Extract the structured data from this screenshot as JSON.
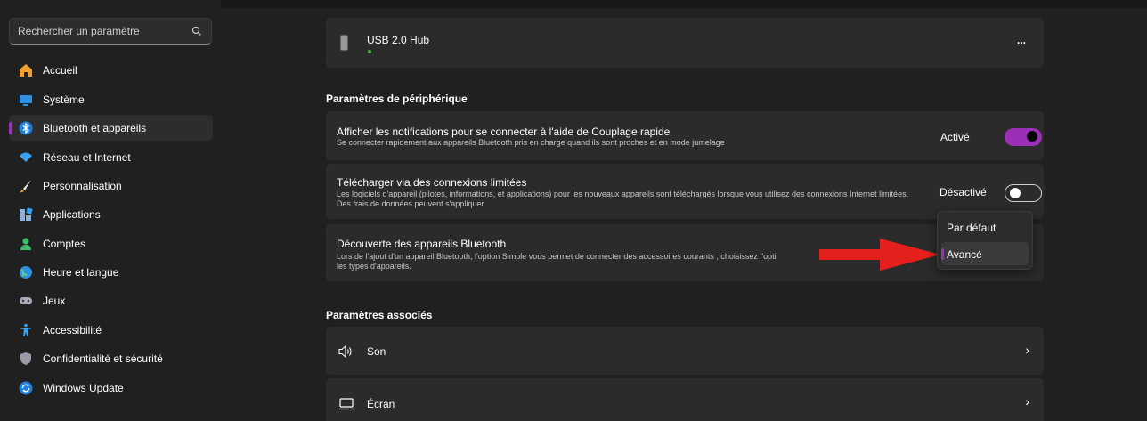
{
  "search": {
    "placeholder": "Rechercher un paramètre"
  },
  "sidebar": {
    "items": [
      {
        "label": "Accueil",
        "icon": "home-icon"
      },
      {
        "label": "Système",
        "icon": "system-icon"
      },
      {
        "label": "Bluetooth et appareils",
        "icon": "bluetooth-icon",
        "selected": true
      },
      {
        "label": "Réseau et Internet",
        "icon": "wifi-icon"
      },
      {
        "label": "Personnalisation",
        "icon": "brush-icon"
      },
      {
        "label": "Applications",
        "icon": "apps-icon"
      },
      {
        "label": "Comptes",
        "icon": "account-icon"
      },
      {
        "label": "Heure et langue",
        "icon": "globe-icon"
      },
      {
        "label": "Jeux",
        "icon": "gamepad-icon"
      },
      {
        "label": "Accessibilité",
        "icon": "accessibility-icon"
      },
      {
        "label": "Confidentialité et sécurité",
        "icon": "shield-icon"
      },
      {
        "label": "Windows Update",
        "icon": "update-icon"
      }
    ]
  },
  "device": {
    "name": "USB 2.0 Hub",
    "more": "...",
    "status_color": "#3fb950"
  },
  "device_settings": {
    "title": "Paramètres de périphérique",
    "swift_pair": {
      "title": "Afficher les notifications pour se connecter à l'aide de Couplage rapide",
      "subtitle": "Se connecter rapidement aux appareils Bluetooth pris en charge quand ils sont proches et en mode jumelage",
      "state": "Activé"
    },
    "metered": {
      "title": "Télécharger via des connexions limitées",
      "subtitle": "Les logiciels d'appareil (pilotes, informations, et applications) pour les nouveaux appareils sont téléchargés lorsque vous utilisez des connexions Internet limitées. Des frais de données peuvent s'appliquer",
      "state": "Désactivé"
    },
    "discovery": {
      "title": "Découverte des appareils Bluetooth",
      "subtitle": "Lors de l'ajout d'un appareil Bluetooth, l'option Simple vous permet de connecter des accessoires courants ; choisissez l'opti",
      "subtitle2": "les types d'appareils.",
      "options": [
        "Par défaut",
        "Avancé"
      ],
      "selected": "Avancé"
    }
  },
  "related": {
    "title": "Paramètres associés",
    "items": [
      {
        "label": "Son",
        "icon": "speaker-icon"
      },
      {
        "label": "Écran",
        "icon": "monitor-icon"
      }
    ]
  },
  "colors": {
    "accent": "#9b2fb8",
    "arrow": "#e3201b"
  }
}
